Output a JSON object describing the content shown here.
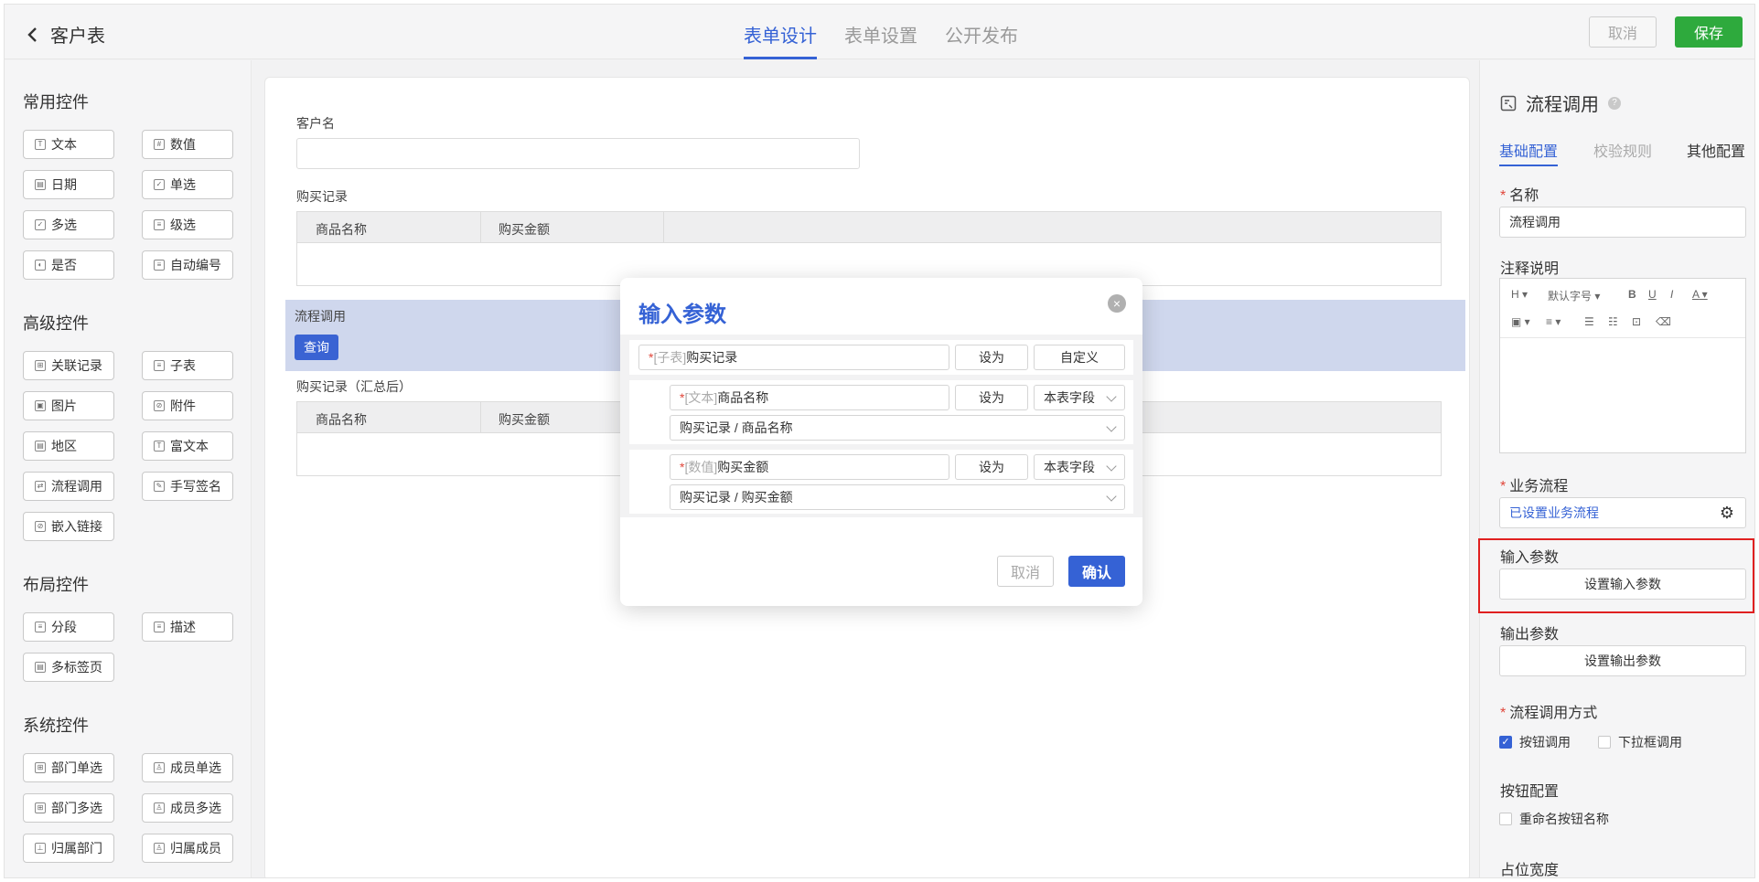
{
  "topbar": {
    "back_label": "客户表",
    "tabs": [
      "表单设计",
      "表单设置",
      "公开发布"
    ],
    "cancel_label": "取消",
    "save_label": "保存"
  },
  "left_panel": {
    "groups": [
      {
        "title": "常用控件",
        "items": [
          "文本",
          "数值",
          "日期",
          "单选",
          "多选",
          "级选",
          "是否",
          "自动编号"
        ]
      },
      {
        "title": "高级控件",
        "items": [
          "关联记录",
          "子表",
          "图片",
          "附件",
          "地区",
          "富文本",
          "流程调用",
          "手写签名",
          "嵌入链接"
        ]
      },
      {
        "title": "布局控件",
        "items": [
          "分段",
          "描述",
          "多标签页"
        ]
      },
      {
        "title": "系统控件",
        "items": [
          "部门单选",
          "成员单选",
          "部门多选",
          "成员多选",
          "归属部门",
          "归属成员"
        ]
      }
    ]
  },
  "canvas": {
    "customer_label": "客户名",
    "purchase_label": "购买记录",
    "purchase_cols": [
      "商品名称",
      "购买金额"
    ],
    "process_label": "流程调用",
    "query_label": "查询",
    "purchase_summary_label": "购买记录（汇总后）",
    "summary_cols": [
      "商品名称",
      "购买金额"
    ]
  },
  "modal": {
    "title": "输入参数",
    "rows": [
      {
        "star": "*",
        "type": "[子表]",
        "name": "购买记录",
        "set_label": "设为",
        "mode": "自定义"
      },
      {
        "star": "*",
        "type": "[文本]",
        "name": "商品名称",
        "set_label": "设为",
        "mode": "本表字段",
        "path": "购买记录 / 商品名称"
      },
      {
        "star": "*",
        "type": "[数值]",
        "name": "购买金额",
        "set_label": "设为",
        "mode": "本表字段",
        "path": "购买记录 / 购买金额"
      }
    ],
    "cancel_label": "取消",
    "ok_label": "确认"
  },
  "right_panel": {
    "title": "流程调用",
    "tabs": [
      "基础配置",
      "校验规则",
      "其他配置"
    ],
    "name_label": "名称",
    "name_value": "流程调用",
    "note_label": "注释说明",
    "toolbar_row1": [
      "H",
      "默认字号",
      "B",
      "U",
      "I",
      "A"
    ],
    "business_label": "业务流程",
    "business_value": "已设置业务流程",
    "input_param_label": "输入参数",
    "input_param_button": "设置输入参数",
    "output_param_label": "输出参数",
    "output_param_button": "设置输出参数",
    "call_mode_label": "流程调用方式",
    "call_mode_options": [
      {
        "label": "按钮调用",
        "checked": true
      },
      {
        "label": "下拉框调用",
        "checked": false
      }
    ],
    "button_config_label": "按钮配置",
    "rename_button_label": "重命名按钮名称",
    "width_label": "占位宽度"
  },
  "colors": {
    "accent": "#3562d5",
    "save_green": "#2eaa3d",
    "required_red": "#e0463a",
    "highlight_red": "#e02020"
  }
}
